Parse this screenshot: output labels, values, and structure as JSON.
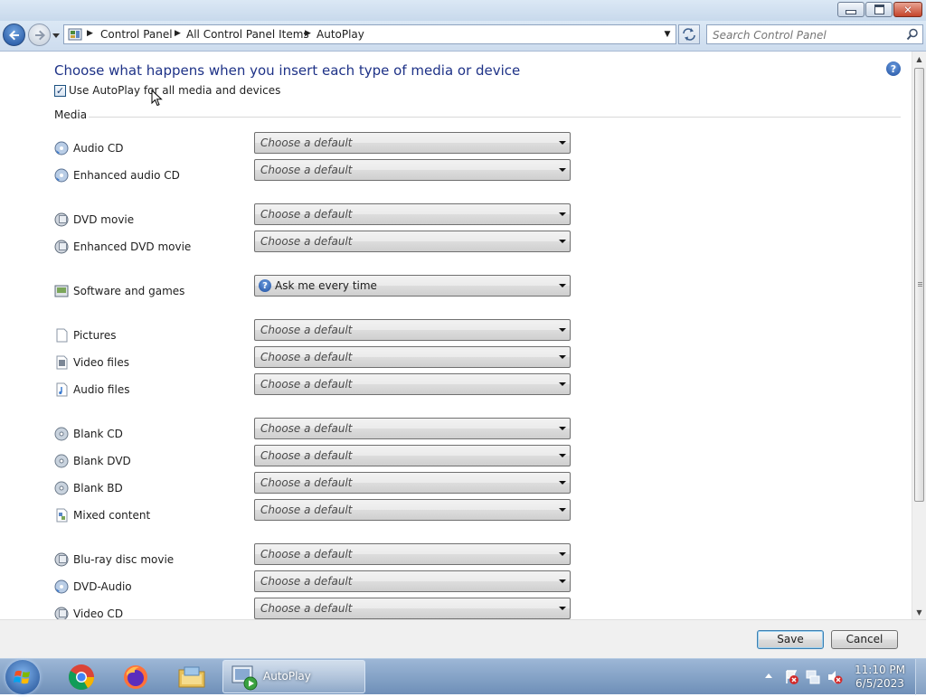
{
  "window": {
    "minimize_icon": "minimize-icon",
    "maximize_icon": "restore-icon",
    "close_icon": "close-icon",
    "close_glyph": "✕"
  },
  "navigation": {
    "back_icon": "back-arrow-icon",
    "forward_icon": "forward-arrow-icon",
    "breadcrumbs": [
      "Control Panel",
      "All Control Panel Items",
      "AutoPlay"
    ],
    "search_placeholder": "Search Control Panel"
  },
  "page": {
    "heading": "Choose what happens when you insert each type of media or device",
    "use_autoplay_label": "Use AutoPlay for all media and devices",
    "use_autoplay_checked": true,
    "section_media": "Media",
    "help_glyph": "?"
  },
  "media_rows": [
    {
      "label": "Audio CD",
      "value": "Choose a default",
      "icon": "audio-cd-icon"
    },
    {
      "label": "Enhanced audio CD",
      "value": "Choose a default",
      "icon": "enhanced-audio-cd-icon"
    },
    {
      "label": "DVD movie",
      "value": "Choose a default",
      "icon": "dvd-movie-icon"
    },
    {
      "label": "Enhanced DVD movie",
      "value": "Choose a default",
      "icon": "enhanced-dvd-icon"
    },
    {
      "label": "Software and games",
      "value": "Ask me every time",
      "icon": "software-games-icon"
    },
    {
      "label": "Pictures",
      "value": "Choose a default",
      "icon": "pictures-icon"
    },
    {
      "label": "Video files",
      "value": "Choose a default",
      "icon": "video-files-icon"
    },
    {
      "label": "Audio files",
      "value": "Choose a default",
      "icon": "audio-files-icon"
    },
    {
      "label": "Blank CD",
      "value": "Choose a default",
      "icon": "blank-cd-icon"
    },
    {
      "label": "Blank DVD",
      "value": "Choose a default",
      "icon": "blank-dvd-icon"
    },
    {
      "label": "Blank BD",
      "value": "Choose a default",
      "icon": "blank-bd-icon"
    },
    {
      "label": "Mixed content",
      "value": "Choose a default",
      "icon": "mixed-content-icon"
    },
    {
      "label": "Blu-ray disc movie",
      "value": "Choose a default",
      "icon": "bluray-icon"
    },
    {
      "label": "DVD-Audio",
      "value": "Choose a default",
      "icon": "dvd-audio-icon"
    },
    {
      "label": "Video CD",
      "value": "Choose a default",
      "icon": "video-cd-icon"
    }
  ],
  "footer": {
    "save_label": "Save",
    "cancel_label": "Cancel"
  },
  "taskbar": {
    "active_task_label": "AutoPlay",
    "time": "11:10 PM",
    "date": "6/5/2023",
    "apps": [
      "chrome-icon",
      "firefox-icon",
      "file-explorer-icon"
    ]
  },
  "colors": {
    "heading": "#1e3287",
    "taskbar": "#7f9ec4",
    "accent": "#3c7fb1"
  }
}
